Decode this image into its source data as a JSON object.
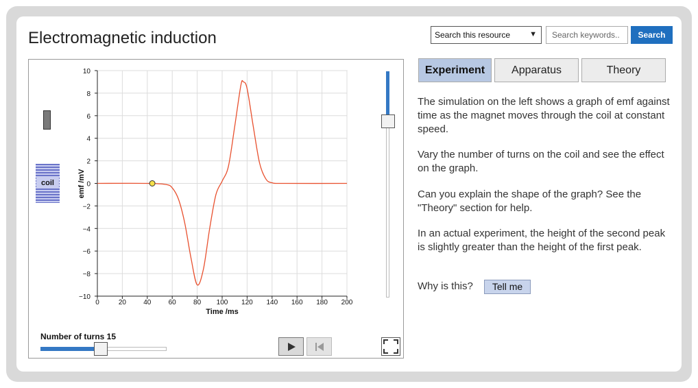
{
  "header": {
    "title": "Electromagnetic induction"
  },
  "search": {
    "scope_selected": "Search this resource",
    "placeholder": "Search keywords..",
    "button_label": "Search"
  },
  "simulation": {
    "coil_label": "coil",
    "turns_label": "Number  of turns 15",
    "turns_value": 15,
    "turns_fraction": 0.48,
    "speed_fraction": 0.22,
    "marker_time_ms": 44
  },
  "tabs": [
    {
      "label": "Experiment",
      "active": true
    },
    {
      "label": "Apparatus",
      "active": false
    },
    {
      "label": "Theory",
      "active": false
    }
  ],
  "content": {
    "paragraphs": [
      "The simulation on the left shows a graph of emf against time as the magnet moves through the coil at constant speed.",
      "Vary the number of turns on the coil and see the effect on the graph.",
      "Can you explain the shape of the graph? See the \"Theory\" section for help.",
      "In an actual experiment, the height of the second peak is slightly greater than the height of the first peak."
    ],
    "question": "Why is this?",
    "tell_me_label": "Tell me"
  },
  "chart_data": {
    "type": "line",
    "xlabel": "Time /ms",
    "ylabel": "emf /mV",
    "xlim": [
      0,
      200
    ],
    "ylim": [
      -10,
      10
    ],
    "x_ticks": [
      0,
      20,
      40,
      60,
      80,
      100,
      120,
      140,
      160,
      180,
      200
    ],
    "y_ticks": [
      10,
      8,
      6,
      4,
      2,
      0,
      -2,
      -4,
      -6,
      -8,
      -10
    ],
    "grid": true,
    "series": [
      {
        "color": "#e8502e",
        "x": [
          0,
          40,
          55,
          60,
          65,
          70,
          75,
          80,
          85,
          90,
          95,
          100,
          105,
          110,
          115,
          117,
          120,
          125,
          130,
          135,
          140,
          150,
          200
        ],
        "y": [
          0,
          0,
          -0.1,
          -0.4,
          -1.4,
          -3.5,
          -6.6,
          -9.0,
          -7.6,
          -4.0,
          -1.0,
          0.2,
          1.5,
          5.0,
          8.7,
          9.0,
          8.4,
          5.0,
          1.8,
          0.4,
          0.05,
          0,
          0
        ]
      }
    ]
  }
}
